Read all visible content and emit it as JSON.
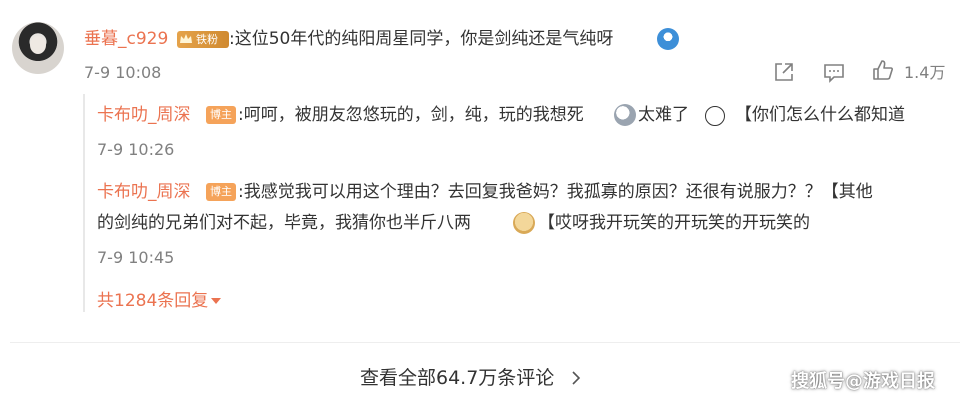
{
  "comment": {
    "username": "垂暮_c929",
    "fan_badge": "铁粉",
    "text": ":这位50年代的纯阳周星同学，你是剑纯还是气纯呀",
    "time": "7-9 10:08",
    "like_count": "1.4万",
    "icons": [
      "share-icon",
      "comment-icon",
      "like-icon"
    ]
  },
  "replies": [
    {
      "username": "卡布叻_周深",
      "badge": "博主",
      "text_part1": ":呵呵，被朋友忽悠玩的，剑，纯，玩的我想死",
      "text_part2": "太难了",
      "text_part3": "【你们怎么什么都知道",
      "time": "7-9 10:26"
    },
    {
      "username": "卡布叻_周深",
      "badge": "博主",
      "line1": ":我感觉我可以用这个理由？去回复我爸妈？我孤寡的原因？还很有说服力？？【其他",
      "line2_part1": "的剑纯的兄弟们对不起，毕竟，我猜你也半斤八两",
      "line2_part2": "【哎呀我开玩笑的开玩笑的开玩笑的",
      "time": "7-9 10:45"
    }
  ],
  "more_replies": "共1284条回复",
  "view_all": "查看全部64.7万条评论",
  "watermark": "搜狐号@游戏日报",
  "colors": {
    "name": "#eb7350",
    "text": "#333333",
    "meta": "#808080",
    "badge_author": "#f5a35a",
    "badge_fan": "#d8953a"
  }
}
